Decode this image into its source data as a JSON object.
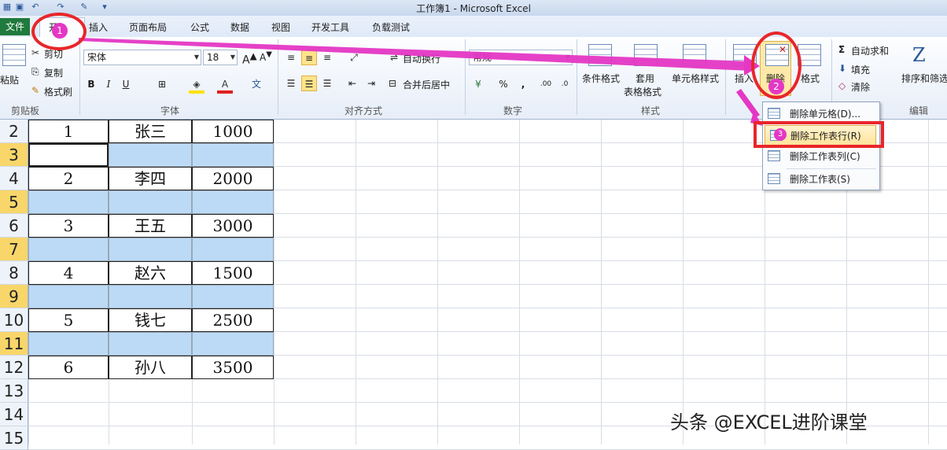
{
  "window": {
    "title": "工作簿1 - Microsoft Excel"
  },
  "quick_access": [
    "save-icon",
    "undo-icon",
    "redo-icon",
    "customize-icon"
  ],
  "tabs": {
    "file": "文件",
    "home": "开",
    "insert": "插入",
    "page_layout": "页面布局",
    "formulas": "公式",
    "data": "数据",
    "review": "视图",
    "developer": "开发工具",
    "load_test": "负载测试"
  },
  "ribbon": {
    "clipboard": {
      "paste": "粘贴",
      "cut": "剪切",
      "copy": "复制",
      "format_painter": "格式刷",
      "label": "剪贴板"
    },
    "font": {
      "name": "宋体",
      "size": "18",
      "label": "字体",
      "bold": "B",
      "italic": "I",
      "underline": "U"
    },
    "alignment": {
      "wrap": "自动换行",
      "merge": "合并后居中",
      "label": "对齐方式"
    },
    "number": {
      "format": "常规",
      "percent": "%",
      "comma": ",",
      "label": "数字"
    },
    "styles": {
      "conditional": "条件格式",
      "table_format_1": "套用",
      "table_format_2": "表格格式",
      "cell_styles": "单元格样式",
      "label": "样式"
    },
    "cells": {
      "insert": "插入",
      "delete": "删除",
      "format": "格式"
    },
    "editing": {
      "autosum": "自动求和",
      "fill": "填充",
      "clear": "清除",
      "sort": "排序和筛选",
      "label": "编辑"
    }
  },
  "delete_menu": {
    "items": [
      "删除单元格(D)...",
      "删除工作表行(R)",
      "删除工作表列(C)",
      "删除工作表(S)"
    ]
  },
  "sheet": {
    "row_numbers": [
      "2",
      "3",
      "4",
      "5",
      "6",
      "7",
      "8",
      "9",
      "10",
      "11",
      "12",
      "13",
      "14",
      "15"
    ],
    "selected_rows": [
      "3",
      "5",
      "7",
      "9",
      "11"
    ],
    "rows": [
      {
        "a": "1",
        "b": "张三",
        "c": "1000"
      },
      {
        "a": "",
        "b": "",
        "c": ""
      },
      {
        "a": "2",
        "b": "李四",
        "c": "2000"
      },
      {
        "a": "",
        "b": "",
        "c": ""
      },
      {
        "a": "3",
        "b": "王五",
        "c": "3000"
      },
      {
        "a": "",
        "b": "",
        "c": ""
      },
      {
        "a": "4",
        "b": "赵六",
        "c": "1500"
      },
      {
        "a": "",
        "b": "",
        "c": ""
      },
      {
        "a": "5",
        "b": "钱七",
        "c": "2500"
      },
      {
        "a": "",
        "b": "",
        "c": ""
      },
      {
        "a": "6",
        "b": "孙八",
        "c": "3500"
      }
    ]
  },
  "annotations": {
    "step1": "1",
    "step2": "2",
    "step3": "3",
    "accent": "#e437c4",
    "ring": "#e8262a"
  },
  "watermark": "头条 @EXCEL进阶课堂"
}
